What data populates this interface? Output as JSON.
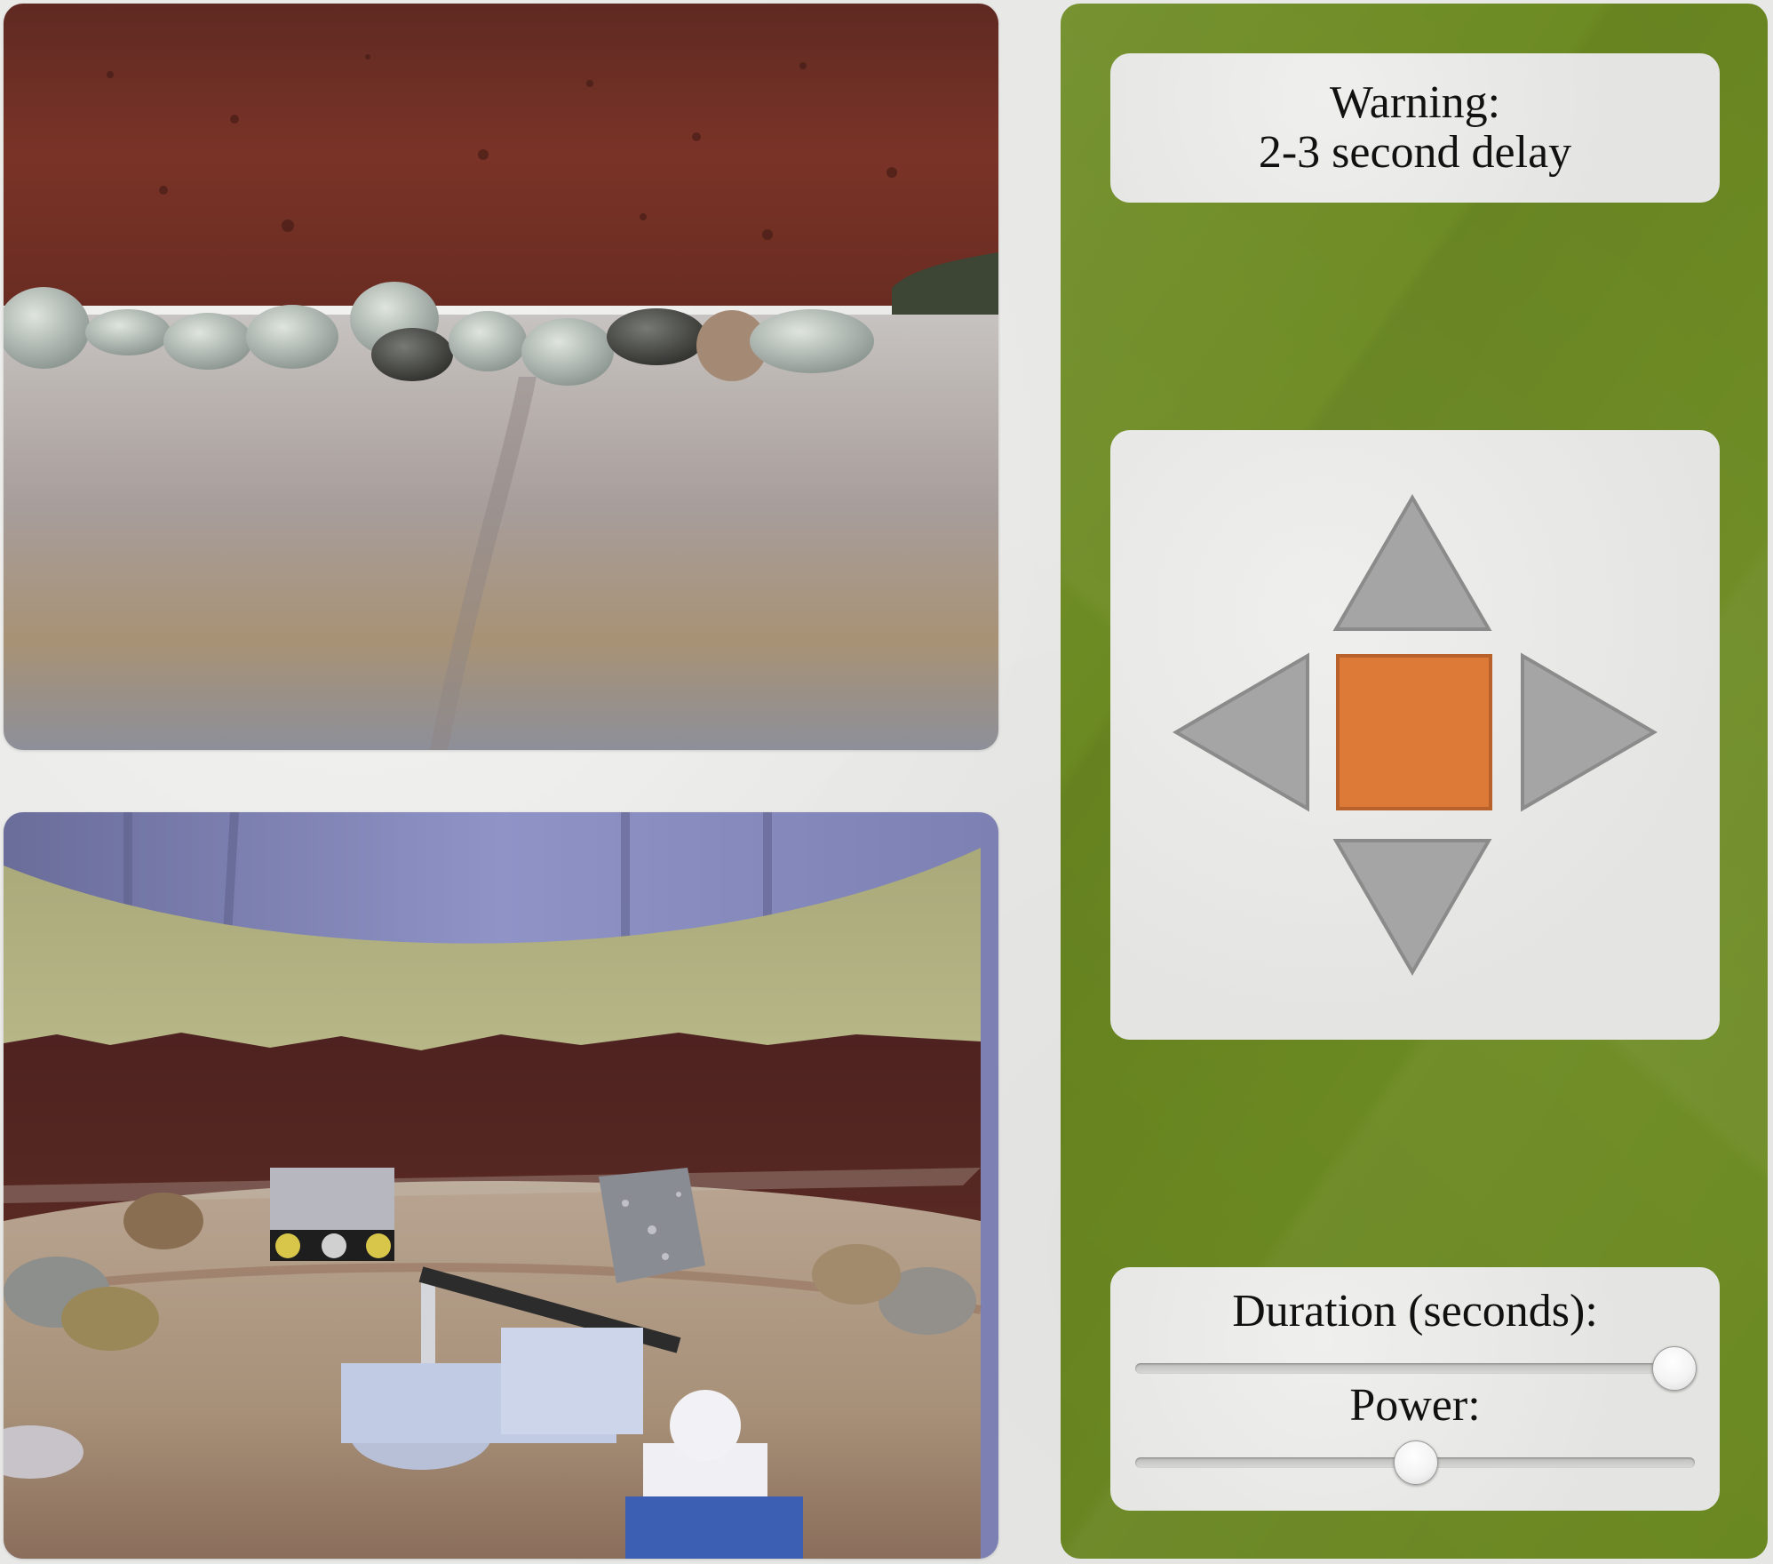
{
  "cameras": {
    "top": {
      "view": "rover-front-camera"
    },
    "bottom": {
      "view": "overhead-arena-camera"
    }
  },
  "warning": {
    "line1": "Warning:",
    "line2": "2-3 second delay"
  },
  "controls": {
    "up": {
      "icon": "arrow-up-icon"
    },
    "left": {
      "icon": "arrow-left-icon"
    },
    "stop": {
      "icon": "stop-icon"
    },
    "right": {
      "icon": "arrow-right-icon"
    },
    "down": {
      "icon": "arrow-down-icon"
    }
  },
  "sliders": {
    "duration": {
      "label": "Duration (seconds):",
      "value_fraction": 1.0
    },
    "power": {
      "label": "Power:",
      "value_fraction": 0.5
    }
  },
  "colors": {
    "panel_green": "#6c8a22",
    "stop_orange": "#de7a38",
    "arrow_gray": "#a5a5a5"
  }
}
